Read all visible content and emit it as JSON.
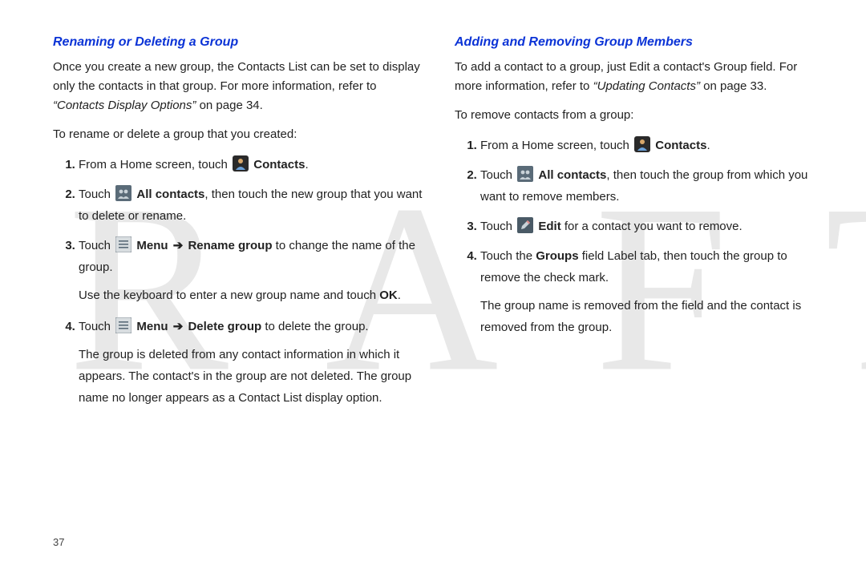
{
  "watermark": "DRAFT",
  "pageNumber": "37",
  "left": {
    "heading": "Renaming or Deleting a Group",
    "intro_pre": "Once you create a new group, the Contacts List can be set to display only the contacts in that group. For more information, refer to ",
    "intro_ref": "“Contacts Display Options”",
    "intro_post": "  on page 34.",
    "lead": "To rename or delete a group that you created:",
    "s1_pre": "From a Home screen, touch ",
    "s1_bold": "Contacts",
    "s1_post": ".",
    "s2_pre": "Touch ",
    "s2_bold": "All contacts",
    "s2_post": ", then touch the new group that you want to delete or rename.",
    "s3_pre": "Touch ",
    "s3_bold1": "Menu",
    "s3_arrow": "➔",
    "s3_bold2": "Rename group",
    "s3_post": " to change the name of the group.",
    "s3_sub_pre": "Use the keyboard to enter a new group name and touch ",
    "s3_sub_bold": "OK",
    "s3_sub_post": ".",
    "s4_pre": "Touch ",
    "s4_bold1": "Menu",
    "s4_arrow": "➔",
    "s4_bold2": "Delete group",
    "s4_post": " to delete the group.",
    "s4_sub": "The group is deleted from any contact information in which it appears. The contact's in the group are not deleted. The group name no longer appears as a Contact List display option."
  },
  "right": {
    "heading": "Adding and Removing Group Members",
    "intro_pre": "To add a contact to a group, just Edit a contact's Group field. For more information, refer to ",
    "intro_ref": "“Updating Contacts”",
    "intro_post": "  on page 33.",
    "lead": "To remove contacts from a group:",
    "s1_pre": "From a Home screen, touch ",
    "s1_bold": "Contacts",
    "s1_post": ".",
    "s2_pre": "Touch ",
    "s2_bold": "All contacts",
    "s2_post": ", then touch the group from which you want to remove members.",
    "s3_pre": "Touch ",
    "s3_bold": "Edit",
    "s3_post": " for a contact you want to remove.",
    "s4_pre": "Touch the ",
    "s4_bold": "Groups",
    "s4_post": " field Label tab, then touch the group to remove the check mark.",
    "s4_sub": "The group name is removed from the field and the contact is removed from the group."
  }
}
